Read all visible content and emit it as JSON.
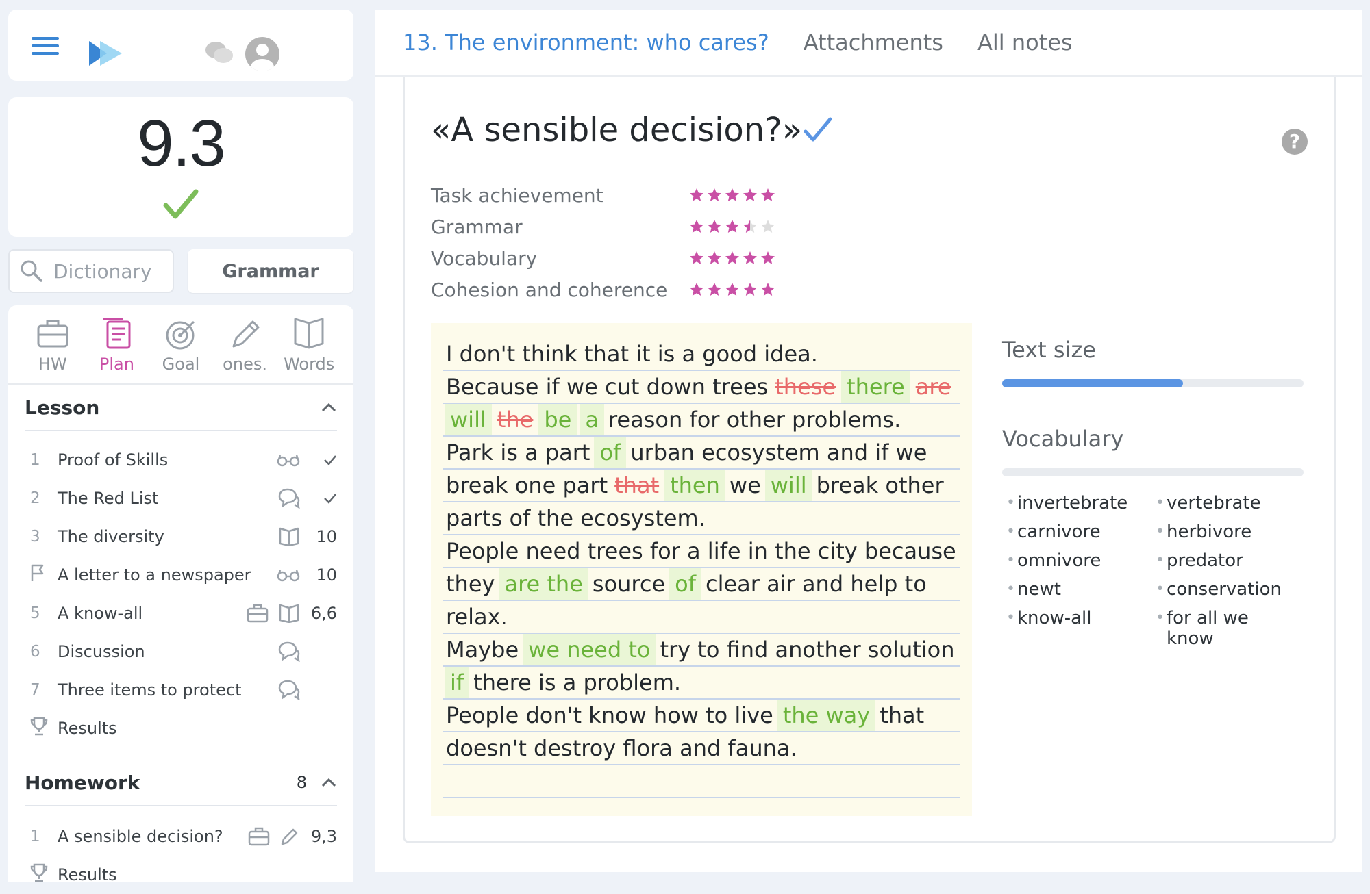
{
  "topbar": {},
  "score": {
    "value": "9.3"
  },
  "search": {
    "placeholder": "Dictionary"
  },
  "grammar_button": "Grammar",
  "nav_tabs": [
    {
      "label": "HW",
      "icon": "briefcase-icon"
    },
    {
      "label": "Plan",
      "icon": "plan-icon"
    },
    {
      "label": "Goal",
      "icon": "target-icon"
    },
    {
      "label": "ones.",
      "icon": "pencil-icon"
    },
    {
      "label": "Words",
      "icon": "book-icon"
    }
  ],
  "lesson": {
    "title": "Lesson",
    "items": [
      {
        "num": "1",
        "label": "Proof of Skills",
        "value": ""
      },
      {
        "num": "2",
        "label": "The Red List",
        "value": ""
      },
      {
        "num": "3",
        "label": "The diversity",
        "value": "10"
      },
      {
        "num": "",
        "label": "A letter to a newspaper",
        "value": "10"
      },
      {
        "num": "5",
        "label": "A know-all",
        "value": "6,6"
      },
      {
        "num": "6",
        "label": "Discussion",
        "value": ""
      },
      {
        "num": "7",
        "label": "Three items to protect",
        "value": ""
      },
      {
        "num": "",
        "label": "Results",
        "value": ""
      }
    ]
  },
  "homework": {
    "title": "Homework",
    "count": "8",
    "items": [
      {
        "num": "1",
        "label": "A sensible decision?",
        "value": "9,3"
      },
      {
        "num": "",
        "label": "Results",
        "value": ""
      }
    ]
  },
  "main_tabs": {
    "active": "13. The environment: who cares?",
    "attachments": "Attachments",
    "notes": "All notes"
  },
  "essay": {
    "title": "«A sensible decision?»",
    "criteria": [
      {
        "name": "Task achievement",
        "rating": 5
      },
      {
        "name": "Grammar",
        "rating": 3.5
      },
      {
        "name": "Vocabulary",
        "rating": 5
      },
      {
        "name": "Cohesion and coherence",
        "rating": 5
      }
    ],
    "lines": [
      [
        [
          "t",
          "I don't think that it is a good idea."
        ]
      ],
      [
        [
          "t",
          "Because if we cut down trees"
        ],
        [
          "d",
          "these"
        ],
        [
          "i",
          "there"
        ],
        [
          "d",
          "are"
        ]
      ],
      [
        [
          "i",
          "will"
        ],
        [
          "d",
          "the"
        ],
        [
          "i",
          "be"
        ],
        [
          "i",
          "a"
        ],
        [
          "t",
          "reason for other problems."
        ]
      ],
      [
        [
          "t",
          "Park is a part"
        ],
        [
          "i",
          "of"
        ],
        [
          "t",
          "urban ecosystem and if we"
        ]
      ],
      [
        [
          "t",
          "break one part"
        ],
        [
          "d",
          "that"
        ],
        [
          "i",
          "then"
        ],
        [
          "t",
          "we"
        ],
        [
          "i",
          "will"
        ],
        [
          "t",
          "break other"
        ]
      ],
      [
        [
          "t",
          "parts of the ecosystem."
        ]
      ],
      [
        [
          "t",
          "People need trees for a life in the city because"
        ]
      ],
      [
        [
          "t",
          "they"
        ],
        [
          "i",
          "are the"
        ],
        [
          "t",
          "source"
        ],
        [
          "i",
          "of"
        ],
        [
          "t",
          "clear air and help to"
        ]
      ],
      [
        [
          "t",
          "relax."
        ]
      ],
      [
        [
          "t",
          "Maybe"
        ],
        [
          "i",
          "we need to"
        ],
        [
          "t",
          "try to find another solution"
        ]
      ],
      [
        [
          "i",
          "if"
        ],
        [
          "t",
          "there is a problem."
        ]
      ],
      [
        [
          "t",
          "People don't know how to live"
        ],
        [
          "i",
          "the way"
        ],
        [
          "t",
          "that"
        ]
      ],
      [
        [
          "t",
          "doesn't destroy flora and fauna."
        ]
      ],
      []
    ]
  },
  "text_size": {
    "title": "Text size",
    "level": 0.6
  },
  "vocabulary": {
    "title": "Vocabulary",
    "progress": 0,
    "words": [
      "invertebrate",
      "vertebrate",
      "carnivore",
      "herbivore",
      "omnivore",
      "predator",
      "newt",
      "conservation",
      "know-all",
      "for all we know"
    ]
  },
  "colors": {
    "accent": "#3d86d6",
    "plan_active": "#c94fa5",
    "star": "#c94fa5",
    "insert_text": "#6ab33a",
    "delete_text": "#e86a6a",
    "check": "#7dbd5a"
  }
}
